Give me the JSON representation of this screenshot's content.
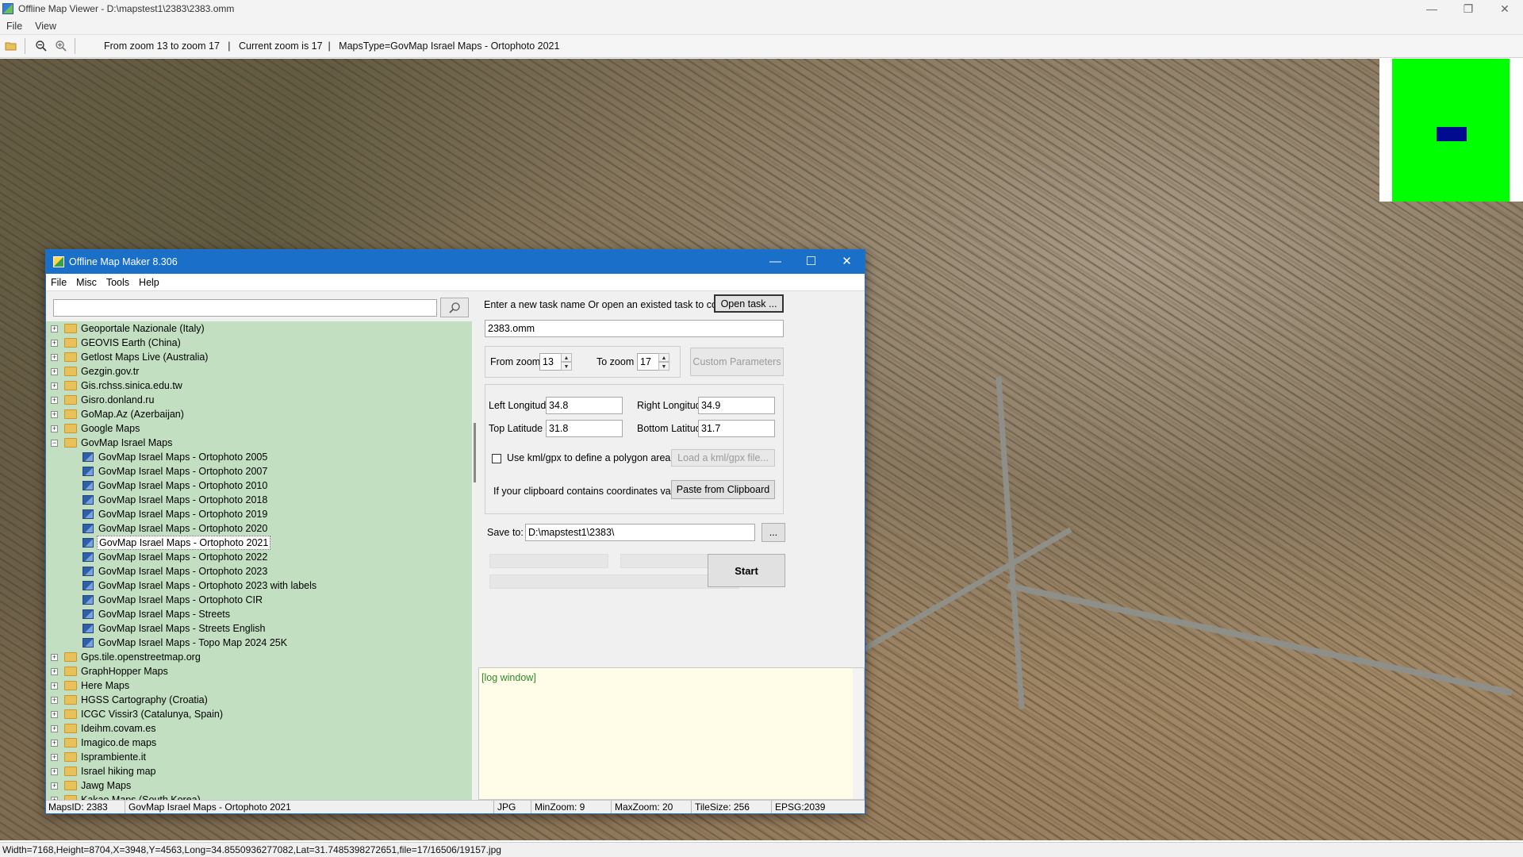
{
  "window": {
    "title": "Offline Map Viewer - D:\\mapstest1\\2383\\2383.omm",
    "controls": [
      "—",
      "❐",
      "✕"
    ]
  },
  "menubar": [
    "File",
    "View"
  ],
  "toolbar": {
    "info": "From zoom 13 to zoom 17   |   Current zoom is 17  |   MapsType=GovMap Israel Maps - Ortophoto 2021"
  },
  "statusbar": "Width=7168,Height=8704,X=3948,Y=4563,Long=34.8550936277082,Lat=31.7485398272651,file=17/16506/19157.jpg",
  "minimap": {
    "frame_color": "#00ff00",
    "viewport_color": "#000b8f"
  },
  "dialog": {
    "title": "Offline Map Maker 8.306",
    "controls": [
      "—",
      "☐",
      "✕"
    ],
    "menu": [
      "File",
      "Misc",
      "Tools",
      "Help"
    ],
    "search": {
      "value": "",
      "icon": "search-icon"
    },
    "tree": [
      {
        "label": "Geoportale Nazionale (Italy)",
        "level": 0,
        "expanded": false
      },
      {
        "label": "GEOVIS Earth (China)",
        "level": 0,
        "expanded": false
      },
      {
        "label": "Getlost Maps Live (Australia)",
        "level": 0,
        "expanded": false
      },
      {
        "label": "Gezgin.gov.tr",
        "level": 0,
        "expanded": false
      },
      {
        "label": "Gis.rchss.sinica.edu.tw",
        "level": 0,
        "expanded": false
      },
      {
        "label": "Gisro.donland.ru",
        "level": 0,
        "expanded": false
      },
      {
        "label": "GoMap.Az (Azerbaijan)",
        "level": 0,
        "expanded": false
      },
      {
        "label": "Google Maps",
        "level": 0,
        "expanded": false
      },
      {
        "label": "GovMap Israel Maps",
        "level": 0,
        "expanded": true
      },
      {
        "label": "GovMap Israel Maps - Ortophoto 2005",
        "level": 1
      },
      {
        "label": "GovMap Israel Maps - Ortophoto 2007",
        "level": 1
      },
      {
        "label": "GovMap Israel Maps - Ortophoto 2010",
        "level": 1
      },
      {
        "label": "GovMap Israel Maps - Ortophoto 2018",
        "level": 1
      },
      {
        "label": "GovMap Israel Maps - Ortophoto 2019",
        "level": 1
      },
      {
        "label": "GovMap Israel Maps - Ortophoto 2020",
        "level": 1
      },
      {
        "label": "GovMap Israel Maps - Ortophoto 2021",
        "level": 1,
        "selected": true
      },
      {
        "label": "GovMap Israel Maps - Ortophoto 2022",
        "level": 1
      },
      {
        "label": "GovMap Israel Maps - Ortophoto 2023",
        "level": 1
      },
      {
        "label": "GovMap Israel Maps - Ortophoto 2023 with labels",
        "level": 1
      },
      {
        "label": "GovMap Israel Maps - Ortophoto CIR",
        "level": 1
      },
      {
        "label": "GovMap Israel Maps - Streets",
        "level": 1
      },
      {
        "label": "GovMap Israel Maps - Streets English",
        "level": 1
      },
      {
        "label": "GovMap Israel Maps - Topo Map 2024 25K",
        "level": 1
      },
      {
        "label": "Gps.tile.openstreetmap.org",
        "level": 0,
        "expanded": false
      },
      {
        "label": "GraphHopper Maps",
        "level": 0,
        "expanded": false
      },
      {
        "label": "Here Maps",
        "level": 0,
        "expanded": false
      },
      {
        "label": "HGSS Cartography (Croatia)",
        "level": 0,
        "expanded": false
      },
      {
        "label": "ICGC Vissir3 (Catalunya, Spain)",
        "level": 0,
        "expanded": false
      },
      {
        "label": "Ideihm.covam.es",
        "level": 0,
        "expanded": false
      },
      {
        "label": "Imagico.de maps",
        "level": 0,
        "expanded": false
      },
      {
        "label": "Isprambiente.it",
        "level": 0,
        "expanded": false
      },
      {
        "label": "Israel hiking map",
        "level": 0,
        "expanded": false
      },
      {
        "label": "Jawg Maps",
        "level": 0,
        "expanded": false
      },
      {
        "label": "Kakao Maps (South Korea)",
        "level": 0,
        "expanded": false
      }
    ],
    "task_prompt": "Enter a new task name Or open an existed task to continue:",
    "open_task_label": "Open task ...",
    "task_name": "2383.omm",
    "from_zoom_label": "From zoom",
    "from_zoom": "13",
    "to_zoom_label": "To zoom",
    "to_zoom": "17",
    "custom_params_label": "Custom Parameters",
    "left_lon_label": "Left Longitude",
    "left_lon": "34.8",
    "right_lon_label": "Right Longitude",
    "right_lon": "34.9",
    "top_lat_label": "Top Latitude",
    "top_lat": "31.8",
    "bottom_lat_label": "Bottom Latitude",
    "bottom_lat": "31.7",
    "kml_label": "Use kml/gpx to define a polygon area",
    "kml_checked": false,
    "load_kml_label": "Load a kml/gpx file...",
    "clipboard_prompt": "If your clipboard contains coordinates values:",
    "paste_label": "Paste from Clipboard",
    "save_to_label": "Save to:",
    "save_to": "D:\\mapstest1\\2383\\",
    "browse_label": "...",
    "start_label": "Start",
    "log_text": "[log window]",
    "status": {
      "maps_id": "MapsID: 2383",
      "maps_name": "GovMap Israel Maps - Ortophoto 2021",
      "format": "JPG",
      "min_zoom": "MinZoom: 9",
      "max_zoom": "MaxZoom: 20",
      "tile_size": "TileSize: 256",
      "epsg": "EPSG:2039"
    }
  }
}
